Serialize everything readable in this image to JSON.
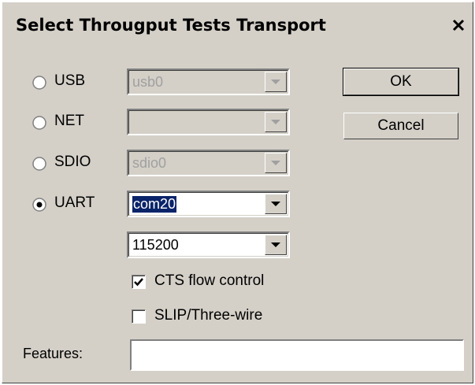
{
  "window": {
    "title": "Select Througput Tests Transport",
    "close_icon": "close-icon"
  },
  "transports": [
    {
      "label": "USB",
      "selected": false,
      "value": "usb0",
      "enabled": false
    },
    {
      "label": "NET",
      "selected": false,
      "value": "",
      "enabled": false
    },
    {
      "label": "SDIO",
      "selected": false,
      "value": "sdio0",
      "enabled": false
    },
    {
      "label": "UART",
      "selected": true,
      "value": "com20",
      "enabled": true
    }
  ],
  "baud_rate": {
    "value": "115200"
  },
  "options": {
    "cts": {
      "label": "CTS flow control",
      "checked": true
    },
    "slip": {
      "label": "SLIP/Three-wire",
      "checked": false
    }
  },
  "features": {
    "label": "Features:",
    "value": ""
  },
  "buttons": {
    "ok": "OK",
    "cancel": "Cancel"
  },
  "colors": {
    "face": "#d4d0c8",
    "highlight": "#0a246a"
  }
}
